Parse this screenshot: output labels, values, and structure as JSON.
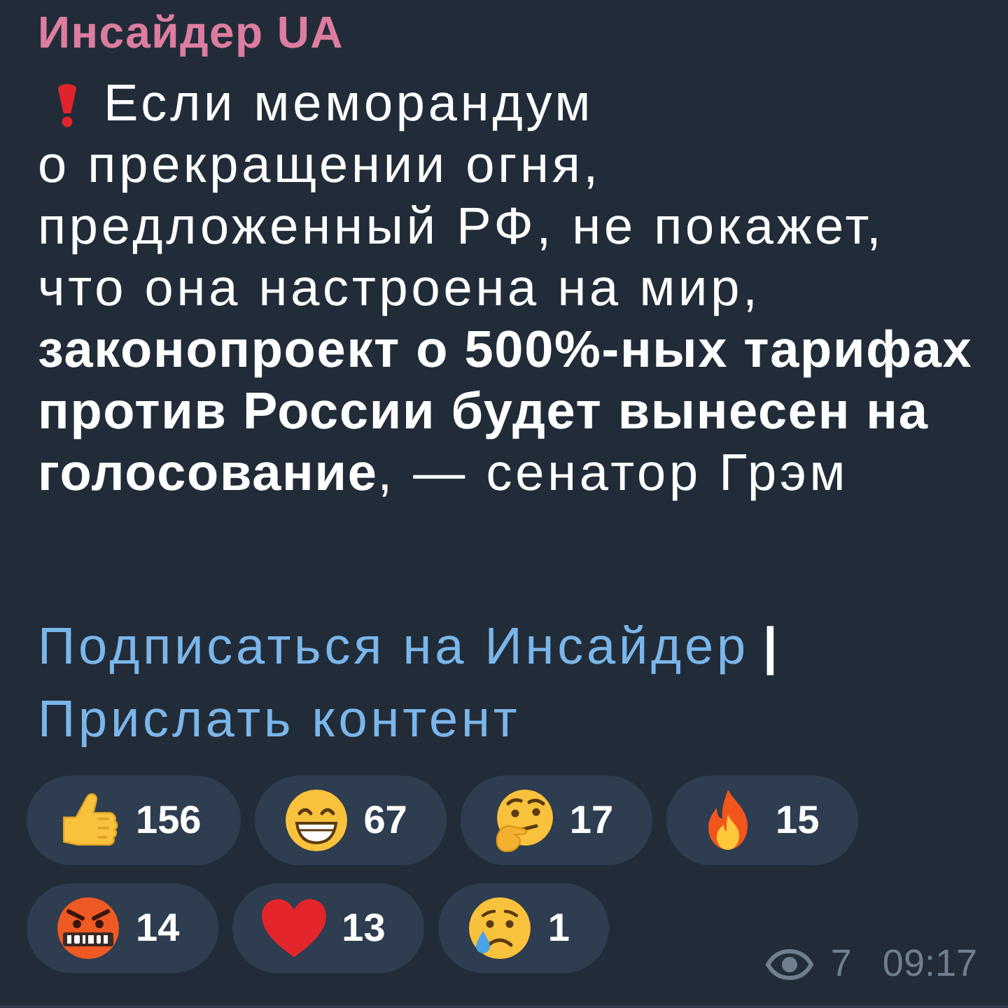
{
  "channel": {
    "name": "Инсайдер UA"
  },
  "message": {
    "lead": "Если меморандум",
    "text": "о прекращении огня,\nпредложенный РФ, не покажет,\nчто она настроена на мир,\n**законопроект о 500%-ных тарифах**\n**против России будет вынесен на**\n**голосование**, — сенатор Грэм"
  },
  "links": [
    {
      "label": "Подписаться на Инсайдер"
    },
    {
      "label": "Прислать контент"
    }
  ],
  "link_separator": "|",
  "reactions": [
    {
      "kind": "thumbs_up",
      "count": "156"
    },
    {
      "kind": "grin",
      "count": "67"
    },
    {
      "kind": "thinking",
      "count": "17"
    },
    {
      "kind": "fire",
      "count": "15"
    },
    {
      "kind": "swearing",
      "count": "14"
    },
    {
      "kind": "heart",
      "count": "13"
    },
    {
      "kind": "crying",
      "count": "1"
    }
  ],
  "meta": {
    "views": "7",
    "time": "09:17"
  }
}
